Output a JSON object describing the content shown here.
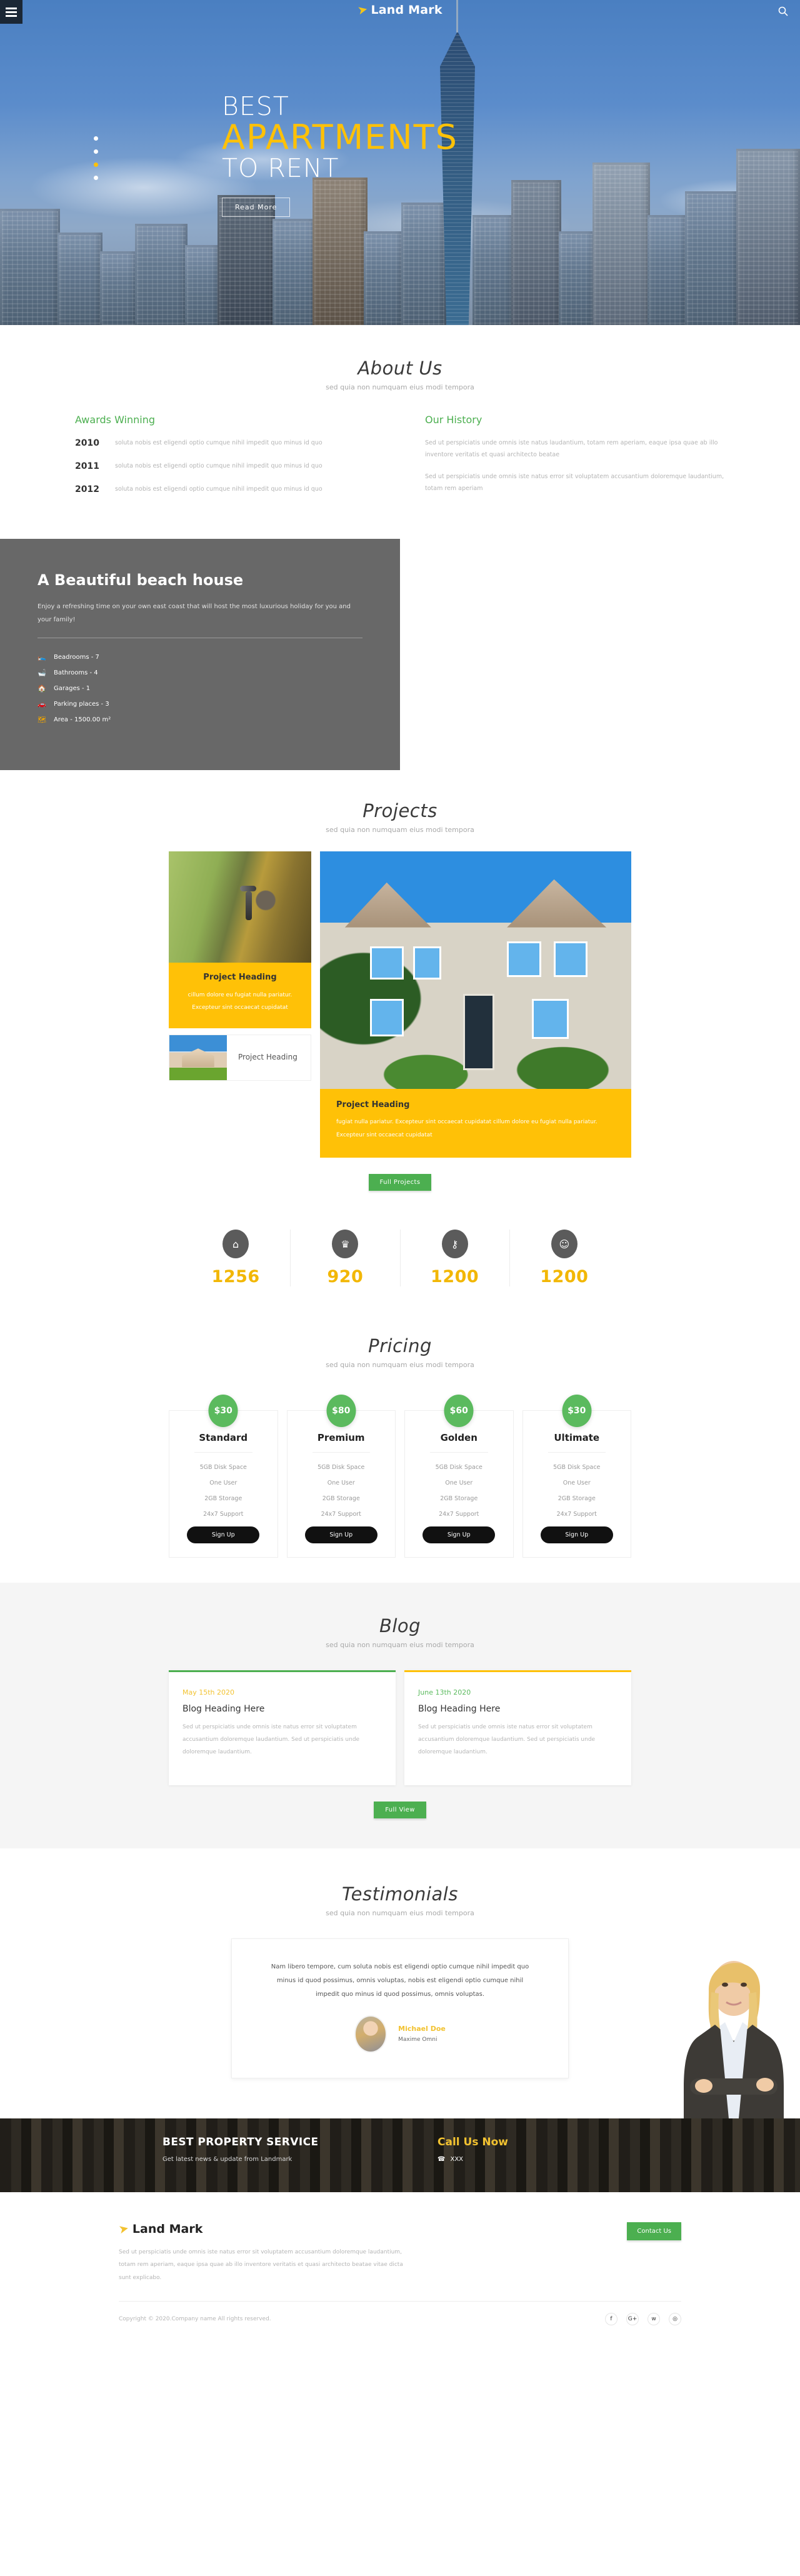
{
  "header": {
    "brand": "Land Mark",
    "menu_icon": "hamburger-menu-icon",
    "search_icon": "search-icon"
  },
  "hero": {
    "line1": "BEST",
    "line2": "APARTMENTS",
    "line3": "TO RENT",
    "cta": "Read More",
    "slider_dots": 4,
    "active_dot": 3
  },
  "about": {
    "title": "About Us",
    "subtitle": "sed quia non numquam eius modi tempora",
    "awards_title": "Awards Winning",
    "awards": [
      {
        "year": "2010",
        "text": "soluta nobis est eligendi optio cumque nihil impedit quo minus id quo"
      },
      {
        "year": "2011",
        "text": "soluta nobis est eligendi optio cumque nihil impedit quo minus id quo"
      },
      {
        "year": "2012",
        "text": "soluta nobis est eligendi optio cumque nihil impedit quo minus id quo"
      }
    ],
    "history_title": "Our History",
    "history": [
      "Sed ut perspiciatis unde omnis iste natus laudantium, totam rem aperiam, eaque ipsa quae ab illo inventore veritatis et quasi architecto beatae",
      "Sed ut perspiciatis unde omnis iste natus error sit voluptatem accusantium doloremque laudantium, totam rem aperiam"
    ]
  },
  "beach": {
    "title": "A Beautiful beach house",
    "lead": "Enjoy a refreshing time on your own east coast that will host the most luxurious holiday for you and your family!",
    "features": [
      {
        "icon": "bed-icon",
        "label": "Beadrooms - 7"
      },
      {
        "icon": "bathtub-icon",
        "label": "Bathrooms - 4"
      },
      {
        "icon": "garage-icon",
        "label": "Garages - 1"
      },
      {
        "icon": "car-icon",
        "label": "Parking places - 3"
      },
      {
        "icon": "area-icon",
        "label": "Area - 1500.00 m²"
      }
    ]
  },
  "projects": {
    "title": "Projects",
    "subtitle": "sed quia non numquam eius modi tempora",
    "card_small": {
      "heading": "Project Heading",
      "text": "cillum dolore eu fugiat nulla pariatur. Excepteur sint occaecat cupidatat"
    },
    "card_tiny": {
      "heading": "Project Heading"
    },
    "card_wide": {
      "heading": "Project Heading",
      "text": "fugiat nulla pariatur. Excepteur sint occaecat cupidatat cillum dolore eu fugiat nulla pariatur. Excepteur sint occaecat cupidatat"
    },
    "button": "Full Projects"
  },
  "stats": [
    {
      "icon": "home-icon",
      "glyph": "⌂",
      "value": "1256"
    },
    {
      "icon": "trophy-icon",
      "glyph": "Ἴ6",
      "value": "920"
    },
    {
      "icon": "key-icon",
      "glyph": "⚷",
      "value": "1200"
    },
    {
      "icon": "smiley-icon",
      "glyph": "☺",
      "value": "1200"
    }
  ],
  "pricing": {
    "title": "Pricing",
    "subtitle": "sed quia non numquam eius modi tempora",
    "plans": [
      {
        "price": "$30",
        "name": "Standard",
        "features": [
          "5GB Disk Space",
          "One User",
          "2GB Storage",
          "24x7 Support"
        ],
        "cta": "Sign Up"
      },
      {
        "price": "$80",
        "name": "Premium",
        "features": [
          "5GB Disk Space",
          "One User",
          "2GB Storage",
          "24x7 Support"
        ],
        "cta": "Sign Up"
      },
      {
        "price": "$60",
        "name": "Golden",
        "features": [
          "5GB Disk Space",
          "One User",
          "2GB Storage",
          "24x7 Support"
        ],
        "cta": "Sign Up"
      },
      {
        "price": "$30",
        "name": "Ultimate",
        "features": [
          "5GB Disk Space",
          "One User",
          "2GB Storage",
          "24x7 Support"
        ],
        "cta": "Sign Up"
      }
    ]
  },
  "blog": {
    "title": "Blog",
    "subtitle": "sed quia non numquam eius modi tempora",
    "posts": [
      {
        "date": "May 15th 2020",
        "heading": "Blog Heading Here",
        "text": "Sed ut perspiciatis unde omnis iste natus error sit voluptatem accusantium doloremque laudantium. Sed ut perspiciatis unde doloremque laudantium."
      },
      {
        "date": "June 13th 2020",
        "heading": "Blog Heading Here",
        "text": "Sed ut perspiciatis unde omnis iste natus error sit voluptatem accusantium doloremque laudantium. Sed ut perspiciatis unde doloremque laudantium."
      }
    ],
    "button": "Full View"
  },
  "testimonials": {
    "title": "Testimonials",
    "subtitle": "sed quia non numquam eius modi tempora",
    "quote": "Nam libero tempore, cum soluta nobis est eligendi optio cumque nihil impedit quo minus id quod possimus, omnis voluptas, nobis est eligendi optio cumque nihil impedit quo minus id quod possimus, omnis voluptas.",
    "name": "Michael Doe",
    "role": "Maxime Omni"
  },
  "cta_banner": {
    "title": "BEST PROPERTY SERVICE",
    "subtitle": "Get latest news & update from Landmark",
    "call_title": "Call Us Now",
    "phone": "XXX",
    "phone_icon": "phone-icon"
  },
  "footer": {
    "brand": "Land Mark",
    "about": "Sed ut perspiciatis unde omnis iste natus error sit voluptatem accusantium doloremque laudantium, totam rem aperiam, eaque ipsa quae ab illo inventore veritatis et quasi architecto beatae vitae dicta sunt explicabo.",
    "contact_button": "Contact Us",
    "copyright": "Copyright © 2020.Company name All rights reserved.",
    "socials": [
      {
        "icon": "facebook-icon",
        "glyph": "f"
      },
      {
        "icon": "google-plus-icon",
        "glyph": "G+"
      },
      {
        "icon": "twitter-icon",
        "glyph": "ᴡ"
      },
      {
        "icon": "dribbble-icon",
        "glyph": "◎"
      }
    ]
  },
  "colors": {
    "accent_yellow": "#FFC107",
    "accent_green": "#4CAF50",
    "dark_panel": "#686868",
    "stat_number": "#F2B705"
  }
}
